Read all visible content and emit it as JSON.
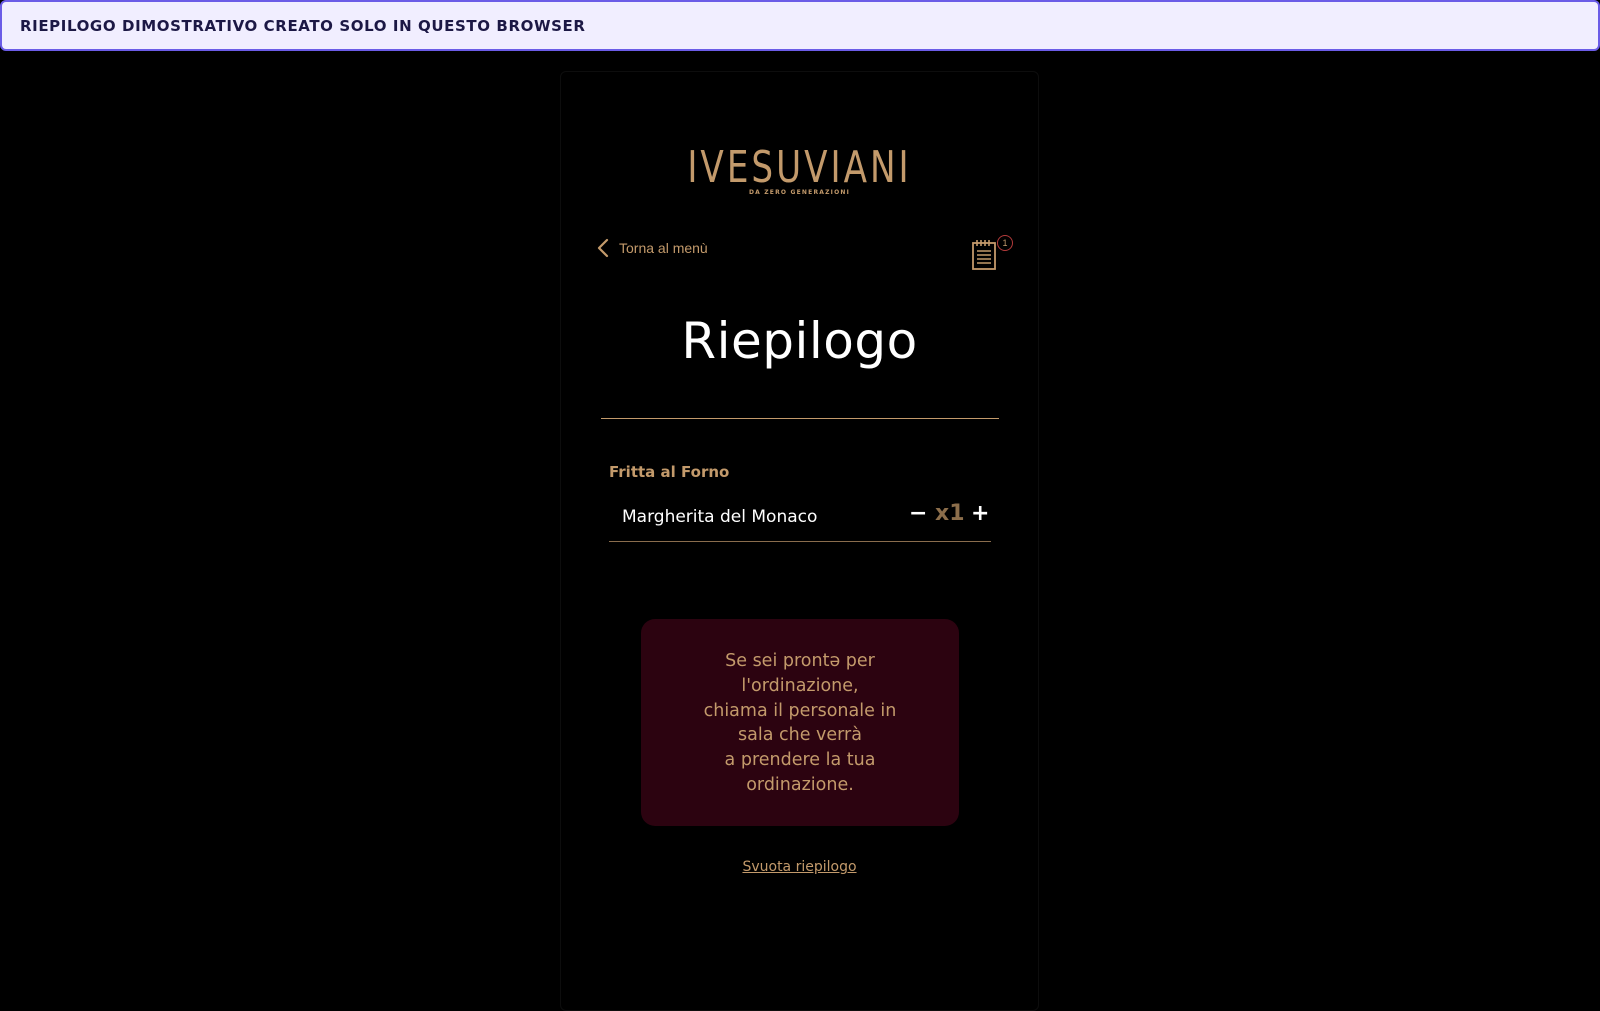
{
  "banner": {
    "text": "RIEPILOGO DIMOSTRATIVO CREATO SOLO IN QUESTO BROWSER"
  },
  "logo": {
    "name": "IVESUVIANI",
    "tagline": "DA ZERO GENERAZIONI"
  },
  "nav": {
    "back_label": "Torna al menù",
    "back_icon": "chevron-left-icon",
    "order_icon": "notepad-icon",
    "order_count": "1"
  },
  "page": {
    "title": "Riepilogo"
  },
  "order": {
    "categories": [
      {
        "name": "Fritta al Forno",
        "items": [
          {
            "name": "Margherita del Monaco",
            "minus_label": "−",
            "quantity": "x1",
            "plus_label": "+"
          }
        ]
      }
    ]
  },
  "info": {
    "lines": [
      "Se sei prontə per",
      "l'ordinazione,",
      "chiama il personale in",
      "sala che verrà",
      "a prendere la tua",
      "ordinazione."
    ]
  },
  "actions": {
    "clear_label": "Svuota riepilogo"
  },
  "colors": {
    "background": "#000000",
    "accent_gold": "#c39a6b",
    "qty_gold": "#8c6e4b",
    "info_box_bg": "#2c0310",
    "banner_bg": "#f1eeff",
    "banner_border": "#6b5ce7",
    "banner_text": "#1c1845",
    "badge_border": "#b23a3a"
  }
}
